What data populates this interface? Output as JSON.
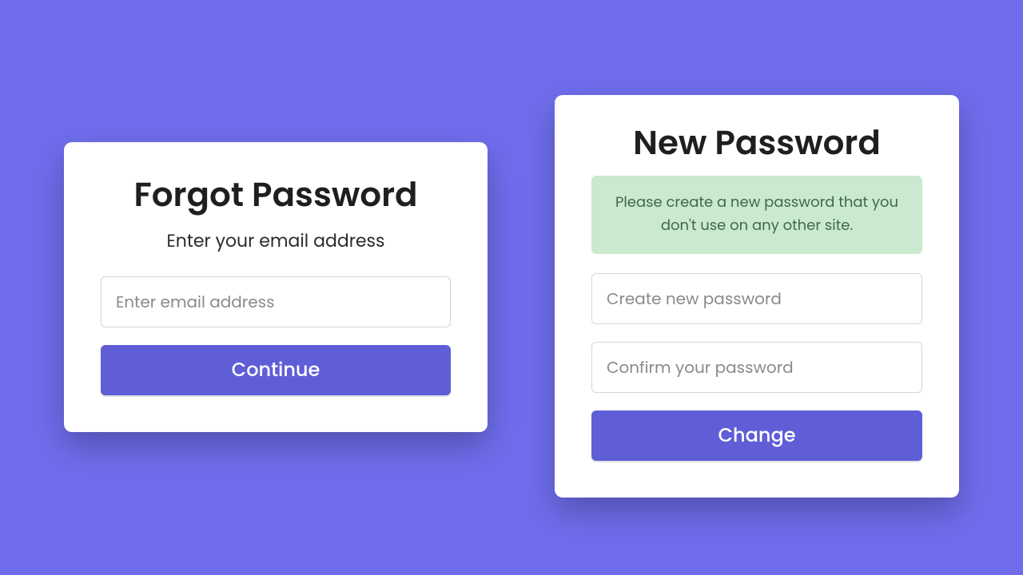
{
  "colors": {
    "background": "#6f6dec",
    "button": "#5f5ed7",
    "alert_bg": "#cbe9ce",
    "alert_text": "#3f6b46"
  },
  "forgot": {
    "title": "Forgot Password",
    "subtitle": "Enter your email address",
    "email_placeholder": "Enter email address",
    "email_value": "",
    "button_label": "Continue"
  },
  "newpw": {
    "title": "New Password",
    "alert_text": "Please create a new password that you don't use on any other site.",
    "password_placeholder": "Create new password",
    "password_value": "",
    "confirm_placeholder": "Confirm your password",
    "confirm_value": "",
    "button_label": "Change"
  }
}
